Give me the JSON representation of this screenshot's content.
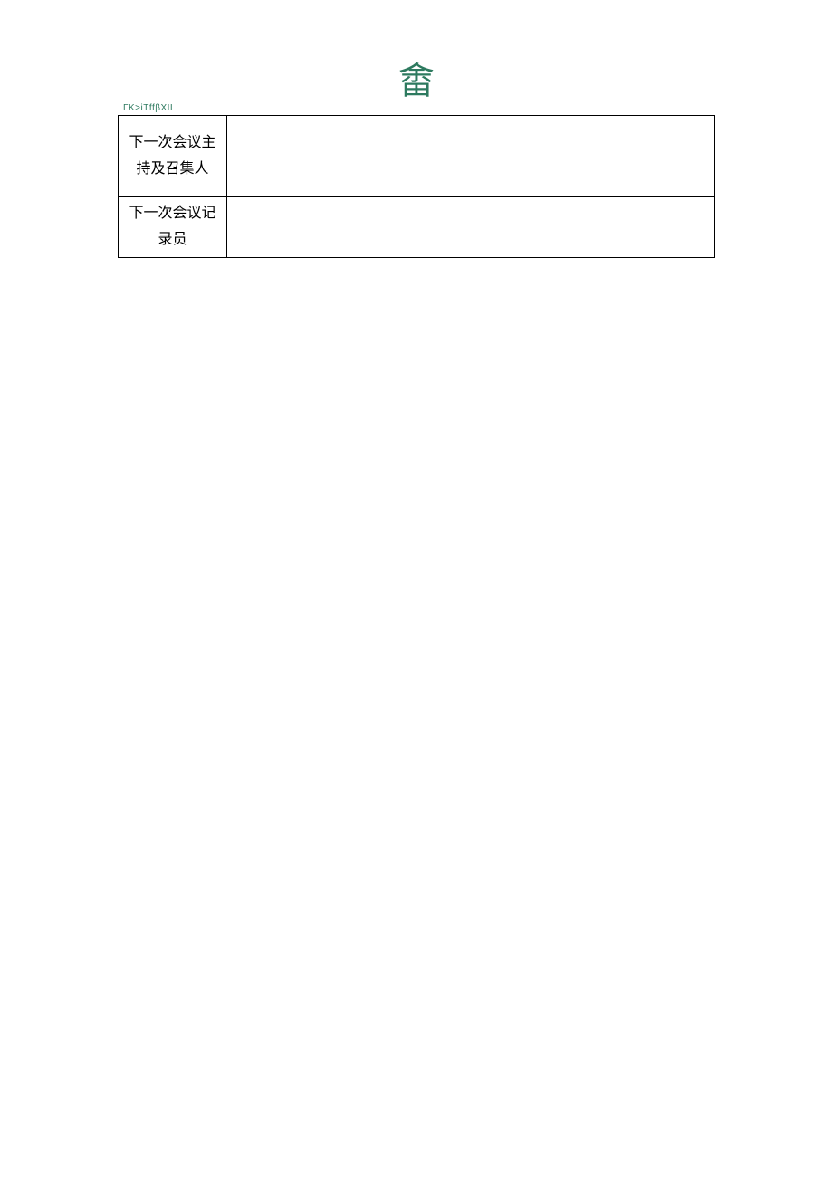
{
  "header": {
    "symbol": "畬",
    "code": "ΓK>iTffβXII"
  },
  "table": {
    "rows": [
      {
        "label": "下一次会议主持及召集人",
        "value": ""
      },
      {
        "label": "下一次会议记录员",
        "value": ""
      }
    ]
  }
}
